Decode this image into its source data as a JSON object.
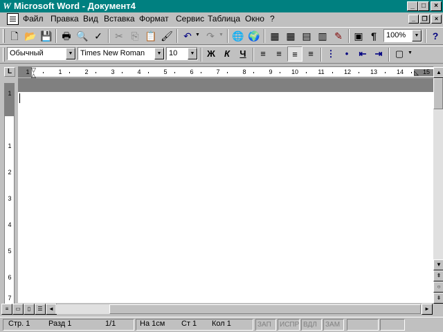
{
  "window": {
    "app_icon": "W",
    "title": "Microsoft Word - Документ4",
    "minimize_glyph": "_",
    "maximize_glyph": "□",
    "close_glyph": "×"
  },
  "menu": {
    "items": [
      "Файл",
      "Правка",
      "Вид",
      "Вставка",
      "Формат",
      "Сервис",
      "Таблица",
      "Окно",
      "?"
    ],
    "doc_minimize_glyph": "_",
    "doc_restore_glyph": "❐",
    "doc_close_glyph": "×"
  },
  "standard_toolbar": {
    "icons": {
      "new": "🗋",
      "open": "📂",
      "save": "💾",
      "print": "🖶",
      "preview": "🔍",
      "spelling": "✓",
      "cut": "✂",
      "copy": "⎘",
      "paste": "📋",
      "format_painter": "🖌",
      "undo": "↶",
      "redo": "↷",
      "hyperlink": "🌐",
      "web_toolbar": "🌍",
      "tables_borders": "▦",
      "insert_table": "▦",
      "insert_excel": "▤",
      "columns": "▥",
      "drawing": "✎",
      "document_map": "▣",
      "show_hide": "¶",
      "help": "?"
    },
    "zoom": "100%",
    "combo_arrow": "▼"
  },
  "formatting_toolbar": {
    "style": "Обычный",
    "font": "Times New Roman",
    "size": "10",
    "bold": "Ж",
    "italic": "К",
    "underline": "Ч",
    "icons": {
      "align_left": "≡",
      "center": "≡",
      "align_right": "≡",
      "justify": "≡",
      "numbering": "⋮",
      "bullets": "•",
      "decrease_indent": "⇤",
      "increase_indent": "⇥",
      "borders": "▢"
    },
    "combo_arrow": "▼"
  },
  "ruler": {
    "corner": "L",
    "numbers": [
      "1",
      "1",
      "2",
      "3",
      "4",
      "5",
      "6",
      "7",
      "8",
      "9",
      "10",
      "11",
      "12",
      "13",
      "14",
      "15"
    ],
    "vnumbers": [
      "1",
      "1",
      "2",
      "3",
      "4",
      "5",
      "6",
      "7"
    ]
  },
  "scroll": {
    "up": "▲",
    "down": "▼",
    "left": "◄",
    "right": "►",
    "prev_page": "⇞",
    "select_browse": "○",
    "next_page": "⇟"
  },
  "view_buttons": {
    "normal": "≡",
    "web": "▭",
    "page": "▯",
    "outline": "☰"
  },
  "status": {
    "page": "Стр. 1",
    "section": "Разд 1",
    "pages": "1/1",
    "at": "На 1см",
    "line": "Ст 1",
    "col": "Кол 1",
    "rec": "ЗАП",
    "trk": "ИСПР",
    "ext": "ВДЛ",
    "ovr": "ЗАМ"
  }
}
